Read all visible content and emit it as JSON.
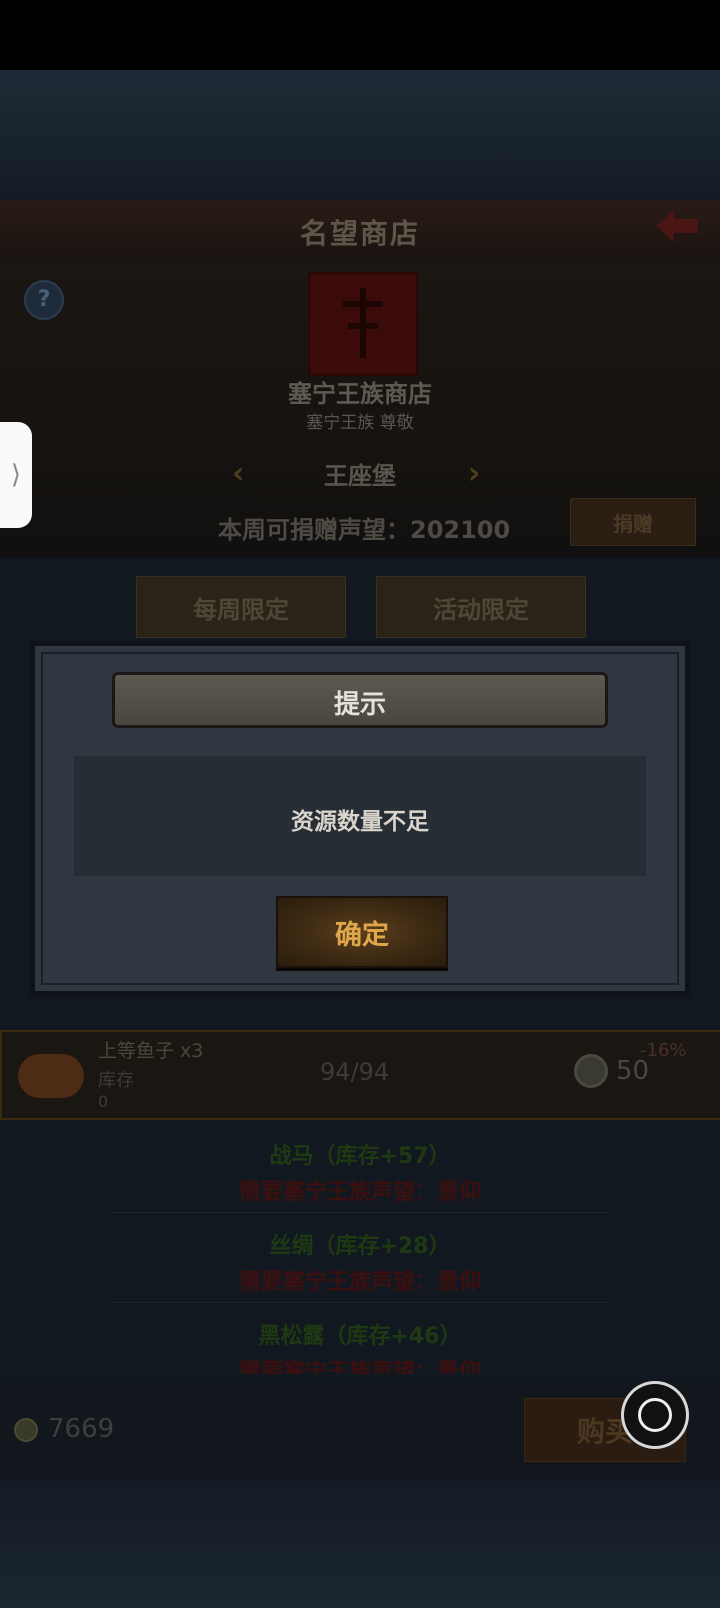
{
  "header": {
    "title": "名望商店"
  },
  "shop": {
    "name": "塞宁王族商店",
    "subtitle": "塞宁王族 尊敬",
    "location": "王座堡",
    "weekly_donation": "本周可捐赠声望：202100",
    "donate_label": "捐赠",
    "help_glyph": "?"
  },
  "tabs": [
    {
      "label": "每周限定"
    },
    {
      "label": "活动限定"
    }
  ],
  "dialog": {
    "title": "提示",
    "message": "资源数量不足",
    "confirm_label": "确定"
  },
  "item": {
    "name": "上等鱼子 x3",
    "stock_label": "库存",
    "stock_value": "0",
    "count": "94/94",
    "discount": "-16%",
    "price": "50"
  },
  "requirements": [
    {
      "name": "战马（库存+57）",
      "need": "需要塞宁王族声望：景仰"
    },
    {
      "name": "丝绸（库存+28）",
      "need": "需要塞宁王族声望：景仰"
    },
    {
      "name": "黑松露（库存+46）",
      "need": "需要塞宁王族声望：景仰"
    }
  ],
  "footer": {
    "currency": "7669",
    "buy_label": "购买"
  },
  "side_handle": "⟩"
}
